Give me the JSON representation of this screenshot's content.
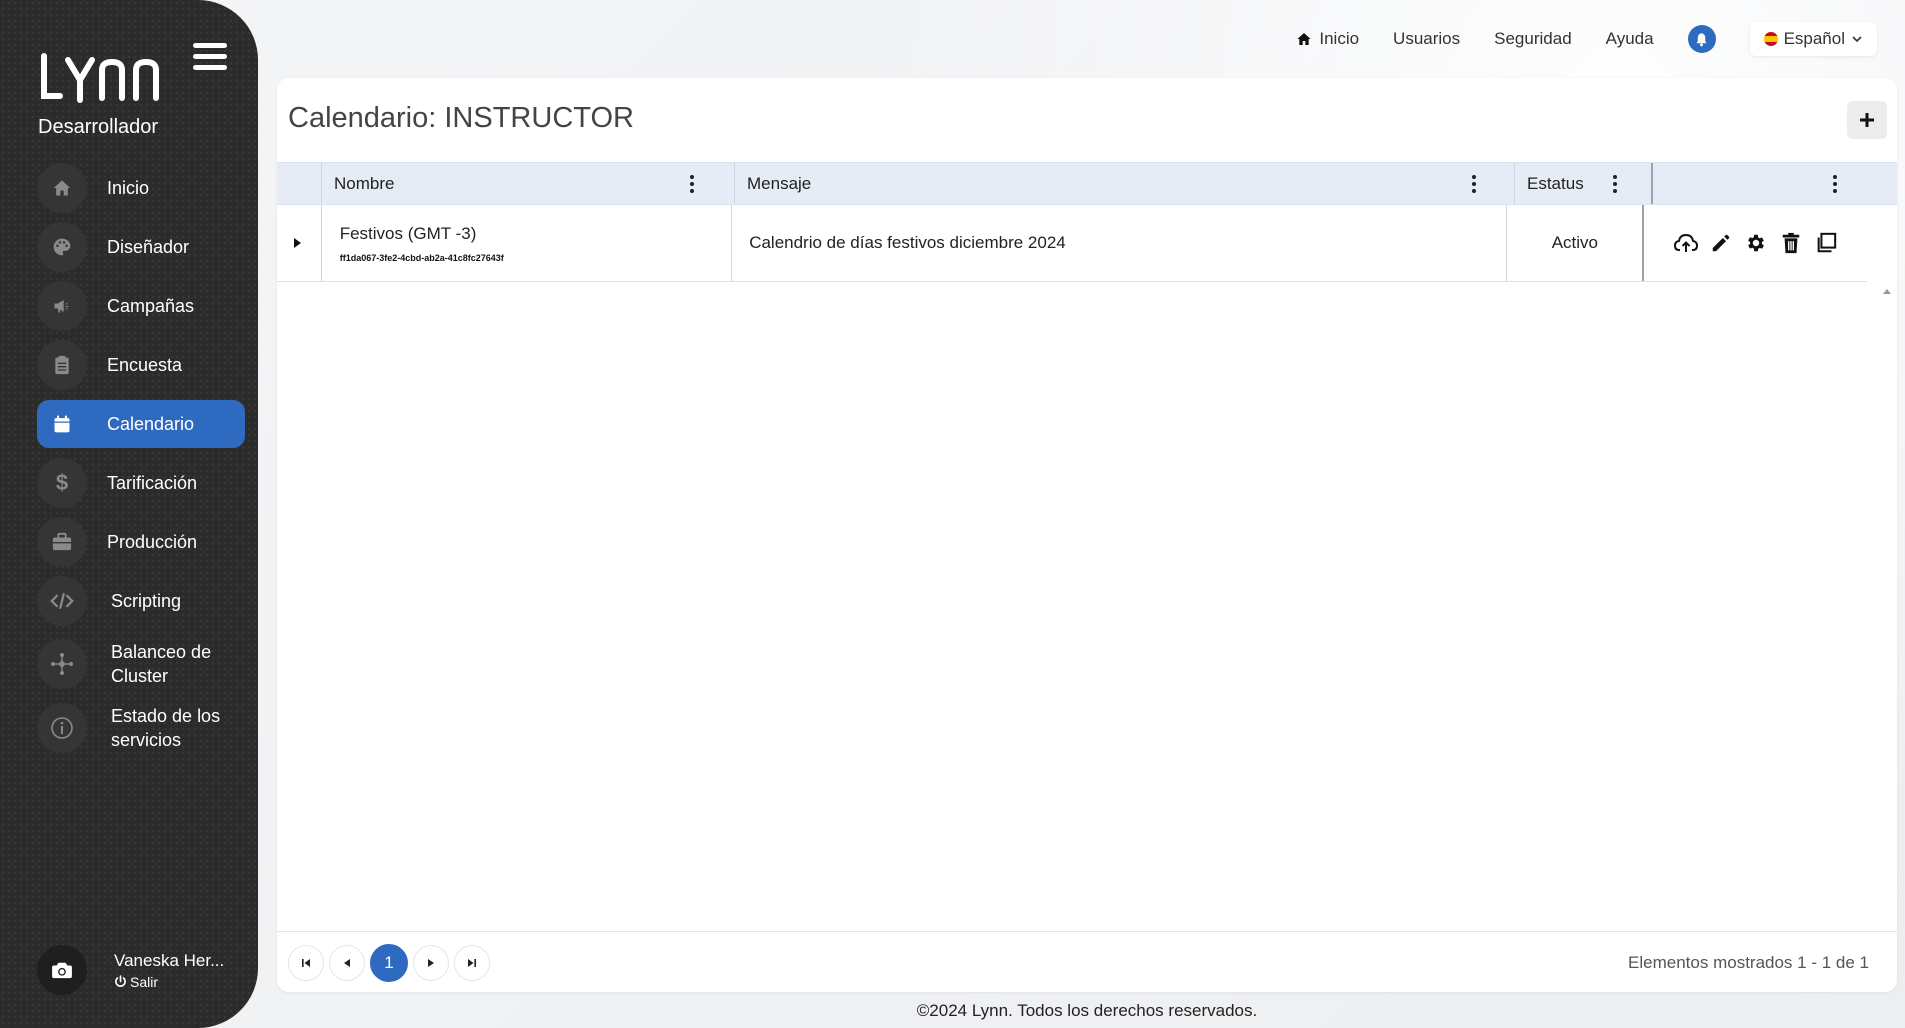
{
  "sidebar": {
    "logo_text": "LYNN",
    "role": "Desarrollador",
    "items": [
      {
        "label": "Inicio",
        "icon": "home-icon"
      },
      {
        "label": "Diseñador",
        "icon": "palette-icon"
      },
      {
        "label": "Campañas",
        "icon": "megaphone-icon"
      },
      {
        "label": "Encuesta",
        "icon": "clipboard-icon"
      },
      {
        "label": "Calendario",
        "icon": "calendar-icon",
        "active": true
      },
      {
        "label": "Tarificación",
        "icon": "dollar-icon"
      },
      {
        "label": "Producción",
        "icon": "briefcase-icon"
      },
      {
        "label": "Scripting",
        "icon": "code-icon"
      },
      {
        "label": "Balanceo de Cluster",
        "icon": "cluster-icon"
      },
      {
        "label": "Estado de los servicios",
        "icon": "info-icon"
      }
    ],
    "user": {
      "name": "Vaneska Her...",
      "logout": "Salir"
    }
  },
  "topbar": {
    "home": "Inicio",
    "users": "Usuarios",
    "security": "Seguridad",
    "help": "Ayuda",
    "language": "Español"
  },
  "page": {
    "title": "Calendario: INSTRUCTOR"
  },
  "grid": {
    "columns": {
      "name": "Nombre",
      "message": "Mensaje",
      "status": "Estatus"
    },
    "rows": [
      {
        "name": "Festivos (GMT -3)",
        "id": "ff1da067-3fe2-4cbd-ab2a-41c8fc27643f",
        "message": "Calendrio de días festivos diciembre 2024",
        "status": "Activo"
      }
    ]
  },
  "pager": {
    "current": "1",
    "info": "Elementos mostrados 1 - 1 de 1"
  },
  "footer": "©2024 Lynn. Todos los derechos reservados.",
  "colors": {
    "accent": "#2e6bc0",
    "sidebar": "#2b2b2b",
    "header": "#e6ecf5"
  }
}
